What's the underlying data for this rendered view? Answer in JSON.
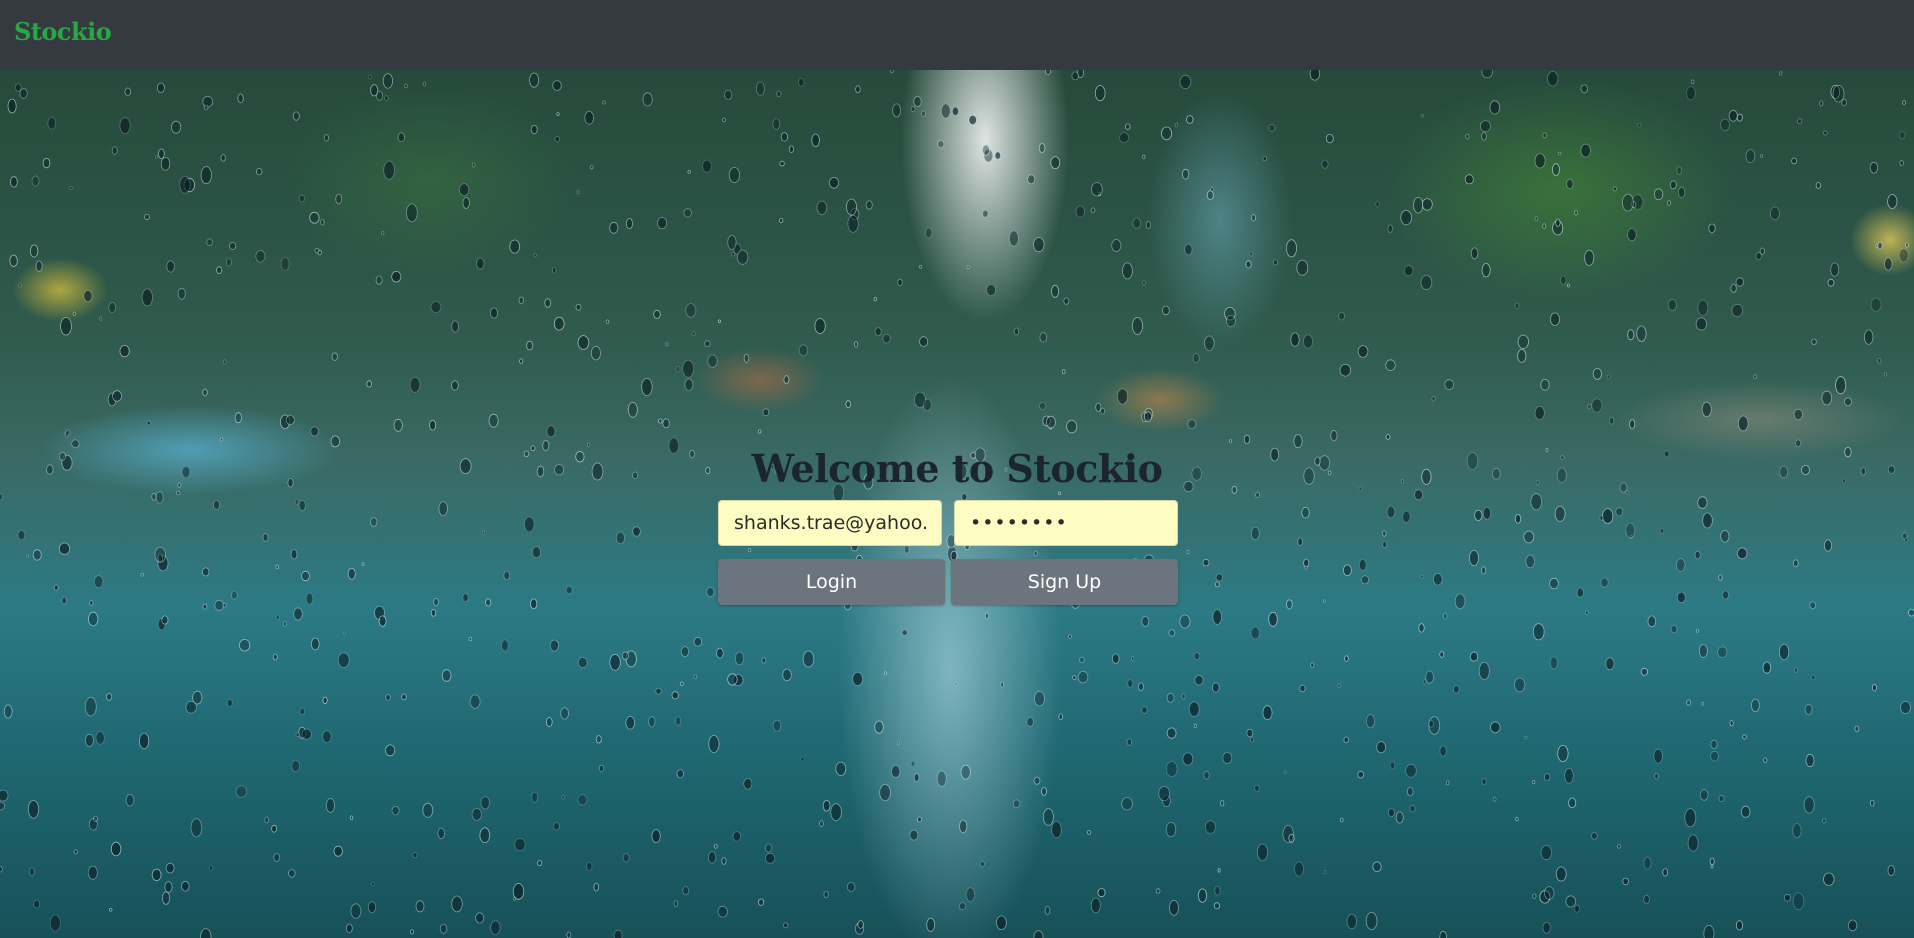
{
  "navbar": {
    "brand": "Stockio",
    "brand_color": "#28a745",
    "background_color": "#343a40"
  },
  "background": {
    "image": "rainy-window-street-scene"
  },
  "login": {
    "title": "Welcome to Stockio",
    "email_value": "shanks.trae@yahoo.com",
    "password_value": "password",
    "login_label": "Login",
    "signup_label": "Sign Up",
    "field_color": "#fdfdc3",
    "button_color": "#6c757d"
  }
}
